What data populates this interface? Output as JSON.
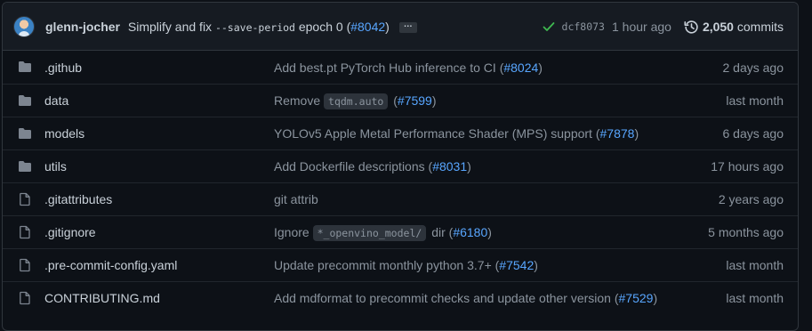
{
  "colors": {
    "accent": "#58a6ff",
    "success": "#3fb950",
    "folder": "#7d8590"
  },
  "latest_commit": {
    "author": "glenn-jocher",
    "message_before_code": "Simplify and fix",
    "message_code": "--save-period",
    "message_after_code": "epoch 0 (",
    "pr": "#8042",
    "message_close": ")",
    "ellipsis": "…",
    "status_icon": "check-icon",
    "sha": "dcf8073",
    "age": "1 hour ago",
    "commit_count": "2,050",
    "commits_label": "commits"
  },
  "files": [
    {
      "type": "folder",
      "icon": "folder-icon",
      "name": ".github",
      "msg_pre": "Add best.pt PyTorch Hub inference to CI (",
      "code": "",
      "msg_mid": "",
      "pr": "#8024",
      "msg_post": ")",
      "age": "2 days ago"
    },
    {
      "type": "folder",
      "icon": "folder-icon",
      "name": "data",
      "msg_pre": "Remove",
      "code": "tqdm.auto",
      "msg_mid": "(",
      "pr": "#7599",
      "msg_post": ")",
      "age": "last month"
    },
    {
      "type": "folder",
      "icon": "folder-icon",
      "name": "models",
      "msg_pre": "YOLOv5 Apple Metal Performance Shader (MPS) support (",
      "code": "",
      "msg_mid": "",
      "pr": "#7878",
      "msg_post": ")",
      "age": "6 days ago"
    },
    {
      "type": "folder",
      "icon": "folder-icon",
      "name": "utils",
      "msg_pre": "Add Dockerfile descriptions (",
      "code": "",
      "msg_mid": "",
      "pr": "#8031",
      "msg_post": ")",
      "age": "17 hours ago"
    },
    {
      "type": "file",
      "icon": "file-icon",
      "name": ".gitattributes",
      "msg_pre": "git attrib",
      "code": "",
      "msg_mid": "",
      "pr": "",
      "msg_post": "",
      "age": "2 years ago"
    },
    {
      "type": "file",
      "icon": "file-icon",
      "name": ".gitignore",
      "msg_pre": "Ignore",
      "code": "*_openvino_model/",
      "msg_mid": "dir (",
      "pr": "#6180",
      "msg_post": ")",
      "age": "5 months ago"
    },
    {
      "type": "file",
      "icon": "file-icon",
      "name": ".pre-commit-config.yaml",
      "msg_pre": "Update precommit monthly python 3.7+ (",
      "code": "",
      "msg_mid": "",
      "pr": "#7542",
      "msg_post": ")",
      "age": "last month"
    },
    {
      "type": "file",
      "icon": "file-icon",
      "name": "CONTRIBUTING.md",
      "msg_pre": "Add mdformat to precommit checks and update other version (",
      "code": "",
      "msg_mid": "",
      "pr": "#7529",
      "msg_post": ")",
      "age": "last month"
    }
  ]
}
